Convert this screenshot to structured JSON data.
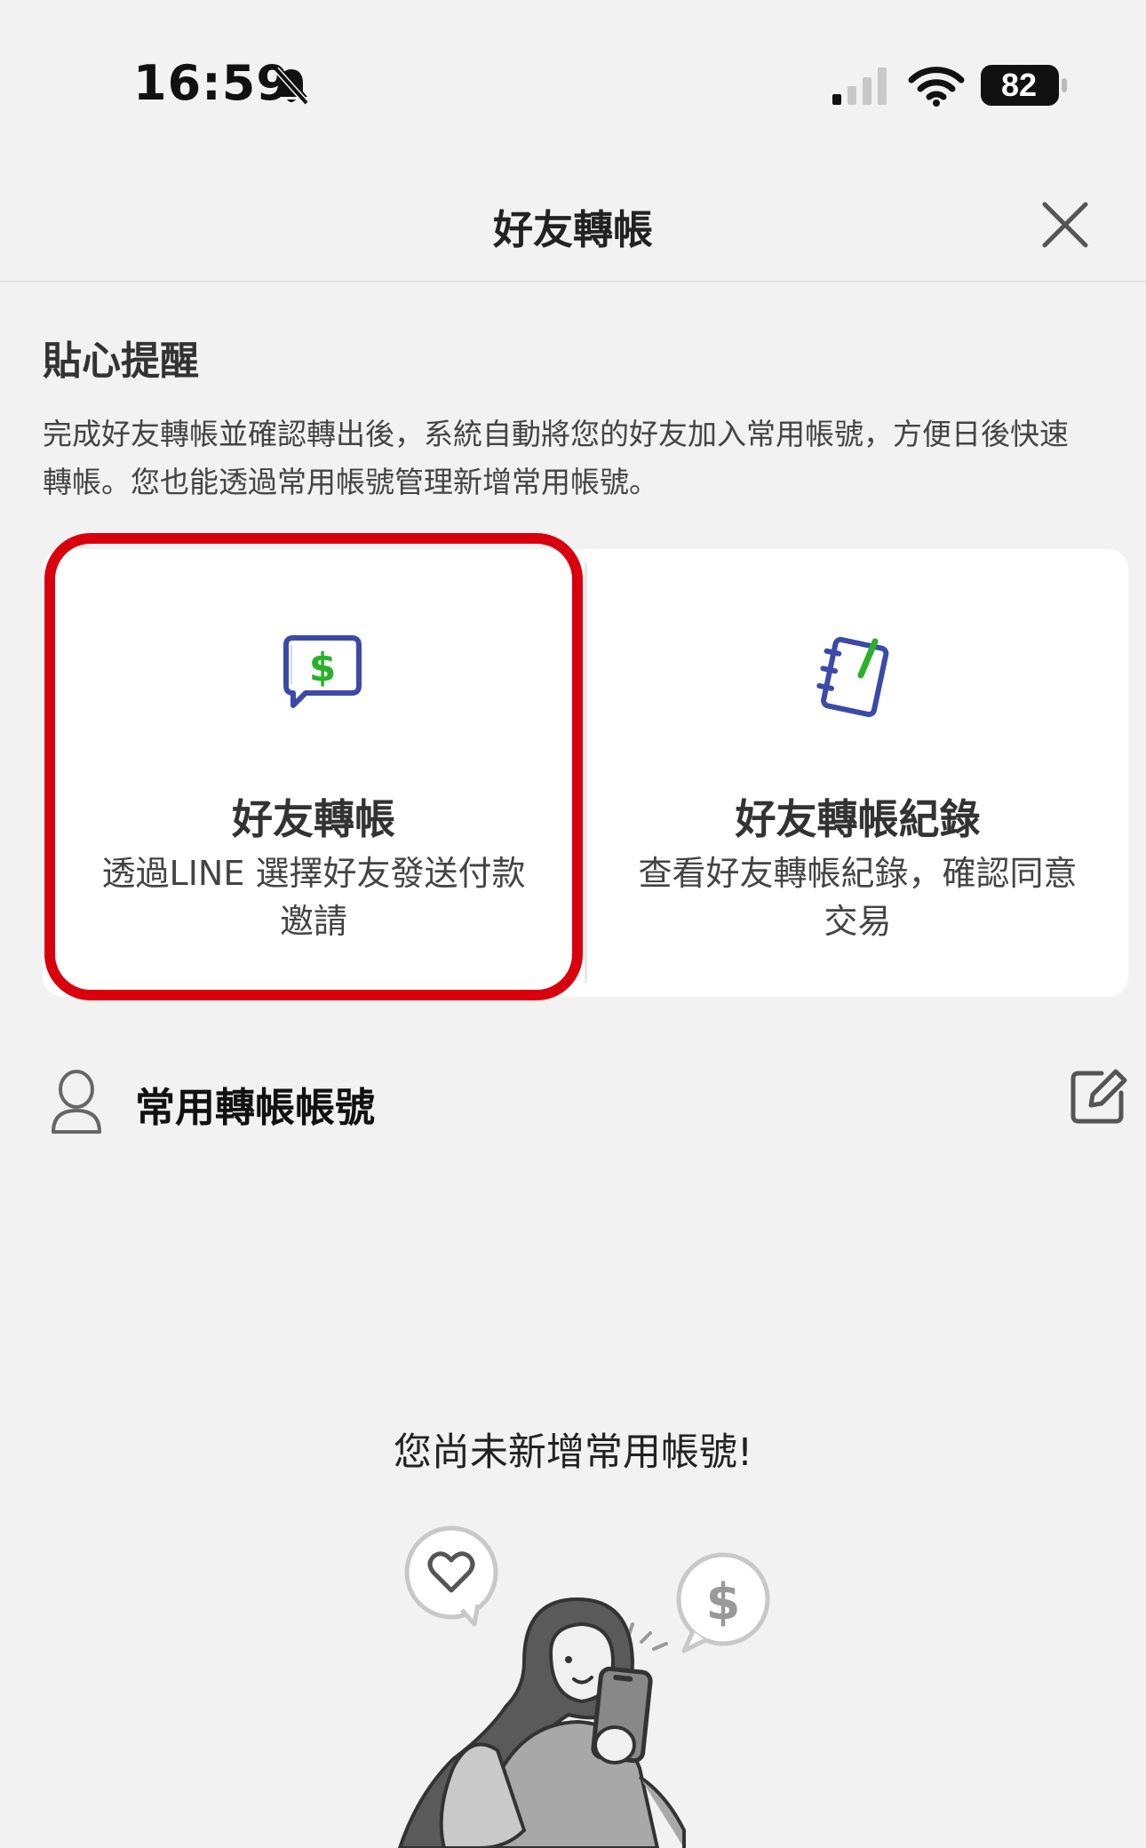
{
  "status_bar": {
    "time": "16:59",
    "battery": "82",
    "icons": [
      "bell-mute-icon",
      "signal-icon",
      "wifi-icon",
      "battery-icon"
    ]
  },
  "header": {
    "title": "好友轉帳",
    "close_icon": "close-icon"
  },
  "notice": {
    "title": "貼心提醒",
    "line1": "完成好友轉帳並確認轉出後，系統自動將您的好友加入常用帳號，方便日後快速",
    "line2": "轉帳。您也能透過常用帳號管理新增常用帳號。"
  },
  "options": [
    {
      "icon": "dollar-chat-icon",
      "title": "好友轉帳",
      "desc_line1": "透過LINE 選擇好友發送付款",
      "desc_line2": "邀請"
    },
    {
      "icon": "notebook-pen-icon",
      "title": "好友轉帳紀錄",
      "desc_line1": "查看好友轉帳紀錄，確認同意",
      "desc_line2": "交易"
    }
  ],
  "accounts": {
    "title": "常用轉帳帳號",
    "user_icon": "user-icon",
    "edit_icon": "edit-icon"
  },
  "empty_state": {
    "text": "您尚未新增常用帳號!"
  },
  "colors": {
    "background": "#f2f2f2",
    "card": "#ffffff",
    "highlight": "#d8000c",
    "icon_blue": "#3b4aa8",
    "icon_green": "#2ab02a"
  }
}
